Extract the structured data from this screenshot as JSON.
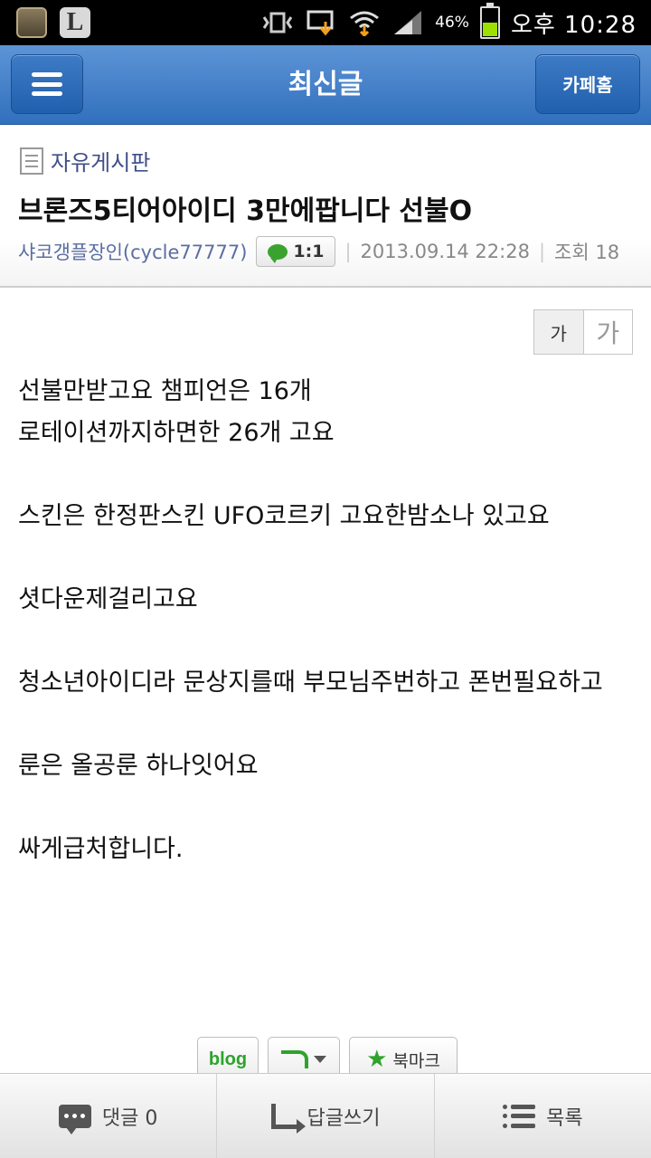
{
  "statusbar": {
    "battery_percent": "46%",
    "battery_level": 0.46,
    "time": "오후 10:28",
    "icons": [
      "tea-app-icon",
      "l-app-icon",
      "vibrate-icon",
      "download-icon",
      "wifi-icon",
      "signal-icon",
      "battery-icon"
    ],
    "app_l_glyph": "L"
  },
  "header": {
    "title": "최신글",
    "cafe_home_label": "카페홈"
  },
  "post": {
    "board_name": "자유게시판",
    "title": "브론즈5티어아이디 3만에팝니다 선불O",
    "author": "샤코갱플장인(cycle77777)",
    "chat_label": "1:1",
    "separator": "|",
    "datetime": "2013.09.14 22:28",
    "views": "조회 18"
  },
  "font_toggle": {
    "small": "가",
    "large": "가"
  },
  "content": {
    "lines": [
      "선불만받고요 챔피언은 16개",
      "로테이션까지하면한 26개 고요",
      "",
      "스킨은 한정판스킨 UFO코르키 고요한밤소나 있고요",
      "",
      "셧다운제걸리고요",
      "",
      "청소년아이디라 문상지를때 부모님주번하고 폰번필요하고",
      "",
      "룬은 올공룬 하나잇어요",
      "",
      "싸게급처합니다."
    ]
  },
  "share": {
    "blog_label": "blog",
    "bookmark_label": "북마크"
  },
  "bottombar": {
    "comment_label": "댓글 0",
    "reply_label": "답글쓰기",
    "list_label": "목록"
  }
}
